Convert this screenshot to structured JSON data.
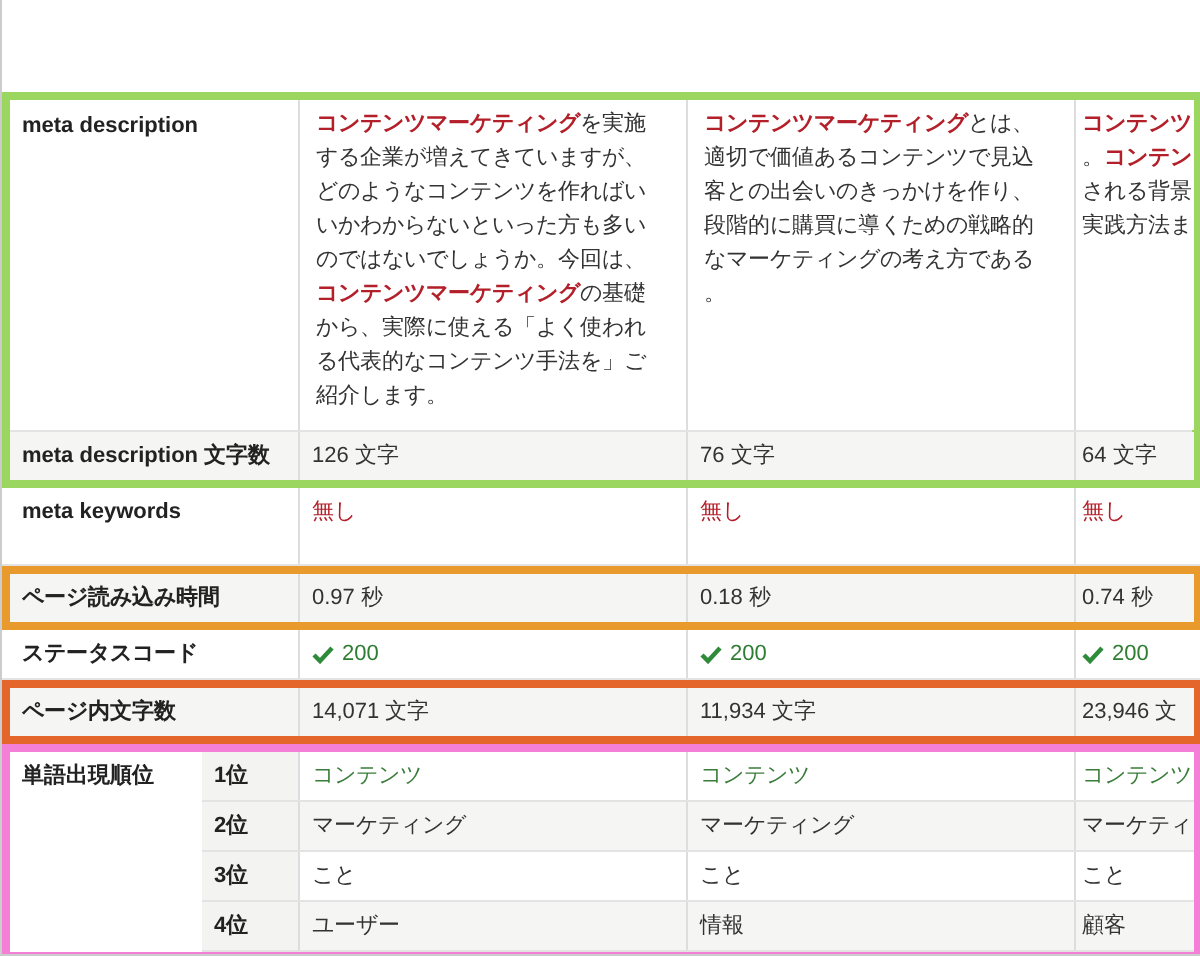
{
  "groups": [
    {
      "color": "#9ad660",
      "rows": [
        {
          "kind": "description",
          "label": "meta description",
          "cells": [
            [
              {
                "text": "コンテンツマーケティング",
                "accent": true
              },
              {
                "text": "を実施する企業が増えてきていますが、どのようなコンテンツを作ればいいかわからないといった方も多いのではないでしょうか。今回は、",
                "accent": false
              },
              {
                "text": "コンテンツマーケティング",
                "accent": true
              },
              {
                "text": "の基礎から、実際に使える「よく使われる代表的なコンテンツ手法を」ご紹介します。",
                "accent": false
              }
            ],
            [
              {
                "text": "コンテンツマーケティング",
                "accent": true
              },
              {
                "text": "とは、適切で価値あるコンテンツで見込客との出会いのきっかけを作り、段階的に購買に導くための戦略的なマーケティングの考え方である。",
                "accent": false
              }
            ],
            [
              {
                "text": "コンテンツ",
                "accent": true
              },
              {
                "text": "。",
                "accent": false
              },
              {
                "text": "コンテン",
                "accent": true
              },
              {
                "text": "される背景実践方法ま",
                "accent": false
              }
            ]
          ]
        },
        {
          "kind": "text",
          "label": "meta description 文字数",
          "cells": [
            "126 文字",
            "76 文字",
            "64 文字"
          ]
        }
      ]
    },
    {
      "rows": [
        {
          "kind": "missing",
          "label": "meta keywords",
          "cells": [
            "無し",
            "無し",
            "無し"
          ]
        }
      ]
    },
    {
      "color": "#e99a2c",
      "rows": [
        {
          "kind": "text",
          "label": "ページ読み込み時間",
          "cells": [
            "0.97 秒",
            "0.18 秒",
            "0.74 秒"
          ]
        }
      ]
    },
    {
      "rows": [
        {
          "kind": "status",
          "label": "ステータスコード",
          "cells": [
            "200",
            "200",
            "200"
          ]
        }
      ]
    },
    {
      "color": "#e4662a",
      "rows": [
        {
          "kind": "text",
          "label": "ページ内文字数",
          "cells": [
            "14,071 文字",
            "11,934 文字",
            "23,946 文"
          ]
        }
      ]
    },
    {
      "color": "#f47fd6",
      "rows": [
        {
          "kind": "ranking",
          "label": "単語出現順位",
          "ranks": [
            {
              "rank": "1位",
              "accent": true,
              "cells": [
                "コンテンツ",
                "コンテンツ",
                "コンテンツ"
              ]
            },
            {
              "rank": "2位",
              "accent": false,
              "cells": [
                "マーケティング",
                "マーケティング",
                "マーケティ"
              ]
            },
            {
              "rank": "3位",
              "accent": false,
              "cells": [
                "こと",
                "こと",
                "こと"
              ]
            },
            {
              "rank": "4位",
              "accent": false,
              "cells": [
                "ユーザー",
                "情報",
                "顧客"
              ]
            }
          ]
        }
      ]
    }
  ]
}
